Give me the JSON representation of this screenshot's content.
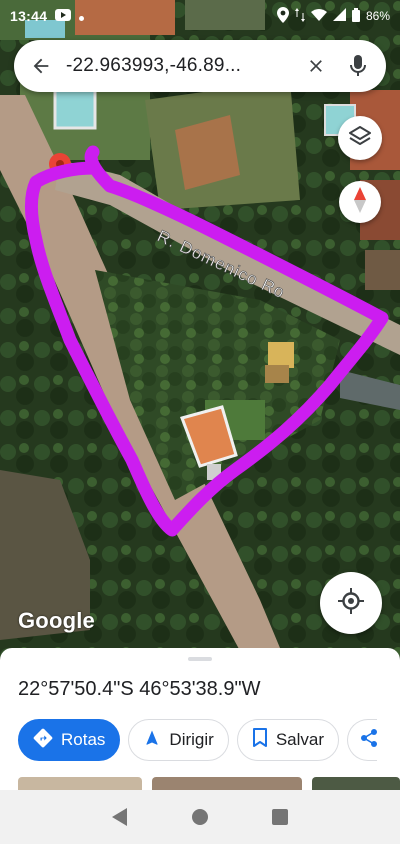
{
  "status": {
    "time": "13:44",
    "battery": "86%"
  },
  "search": {
    "query": "-22.963993,-46.89..."
  },
  "map": {
    "street_label": "R. Domenico Ro",
    "attribution": "Google",
    "drawing_color": "#cc1df0"
  },
  "place": {
    "coordinates": "22°57'50.4\"S 46°53'38.9\"W"
  },
  "actions": [
    {
      "label": "Rotas",
      "icon": "directions-icon"
    },
    {
      "label": "Dirigir",
      "icon": "navigation-arrow-icon"
    },
    {
      "label": "Salvar",
      "icon": "bookmark-icon"
    },
    {
      "label": "",
      "icon": "share-icon"
    }
  ],
  "colors": {
    "accent": "#1a73e8",
    "pin": "#ea4335"
  }
}
